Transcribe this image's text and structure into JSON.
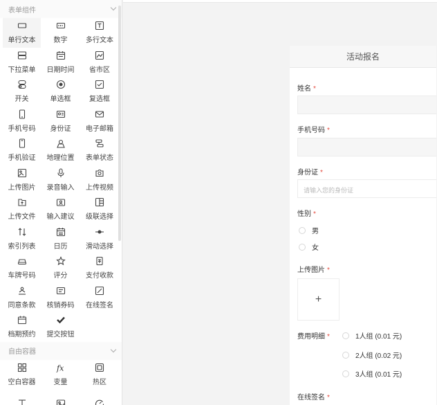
{
  "sidebar": {
    "form_section": "表单组件",
    "container_section": "自由容器",
    "form_items": [
      {
        "label": "单行文本",
        "icon": "single-line-text-icon"
      },
      {
        "label": "数字",
        "icon": "number-icon"
      },
      {
        "label": "多行文本",
        "icon": "multi-line-text-icon"
      },
      {
        "label": "下拉菜单",
        "icon": "dropdown-icon"
      },
      {
        "label": "日期时间",
        "icon": "calendar-icon"
      },
      {
        "label": "省市区",
        "icon": "region-map-icon"
      },
      {
        "label": "开关",
        "icon": "switch-icon"
      },
      {
        "label": "单选框",
        "icon": "radio-icon"
      },
      {
        "label": "复选框",
        "icon": "checkbox-icon"
      },
      {
        "label": "手机号码",
        "icon": "phone-icon"
      },
      {
        "label": "身份证",
        "icon": "id-card-icon"
      },
      {
        "label": "电子邮箱",
        "icon": "mail-icon"
      },
      {
        "label": "手机验证",
        "icon": "phone-verify-icon"
      },
      {
        "label": "地理位置",
        "icon": "location-icon"
      },
      {
        "label": "表单状态",
        "icon": "form-status-icon"
      },
      {
        "label": "上传图片",
        "icon": "image-upload-icon"
      },
      {
        "label": "录音输入",
        "icon": "microphone-icon"
      },
      {
        "label": "上传视频",
        "icon": "video-upload-icon"
      },
      {
        "label": "上传文件",
        "icon": "file-upload-icon"
      },
      {
        "label": "输入建议",
        "icon": "suggestion-icon"
      },
      {
        "label": "级联选择",
        "icon": "cascade-icon"
      },
      {
        "label": "索引列表",
        "icon": "sort-list-icon"
      },
      {
        "label": "日历",
        "icon": "calendar-grid-icon"
      },
      {
        "label": "滑动选择",
        "icon": "slider-icon"
      },
      {
        "label": "车牌号码",
        "icon": "car-icon"
      },
      {
        "label": "评分",
        "icon": "star-icon"
      },
      {
        "label": "支付收款",
        "icon": "payment-icon"
      },
      {
        "label": "同意条款",
        "icon": "agree-icon"
      },
      {
        "label": "核销券码",
        "icon": "coupon-icon"
      },
      {
        "label": "在线签名",
        "icon": "signature-icon"
      },
      {
        "label": "档期预约",
        "icon": "booking-icon"
      },
      {
        "label": "提交按钮",
        "icon": "check-icon"
      }
    ],
    "container_items": [
      {
        "label": "空白容器",
        "icon": "blank-container-icon"
      },
      {
        "label": "变量",
        "icon": "fx-icon"
      },
      {
        "label": "热区",
        "icon": "hotspot-icon"
      },
      {
        "label": "",
        "icon": "text-icon"
      },
      {
        "label": "",
        "icon": "image-icon"
      },
      {
        "label": "",
        "icon": "progress-icon"
      }
    ]
  },
  "form": {
    "title": "活动报名",
    "name_label": "姓名",
    "phone_label": "手机号码",
    "id_label": "身份证",
    "id_placeholder": "请输入您的身份证",
    "gender_label": "性别",
    "gender_options": [
      "男",
      "女"
    ],
    "upload_label": "上传图片",
    "upload_plus": "+",
    "fee_label": "费用明细",
    "fee_options": [
      "1人组 (0.01 元)",
      "2人组 (0.02 元)",
      "3人组 (0.01 元)"
    ],
    "signature_label": "在线签名",
    "required_mark": "*"
  },
  "colors": {
    "required": "#e54d42",
    "panel_bg": "#ffffff",
    "canvas_bg": "#f3f3f3"
  }
}
